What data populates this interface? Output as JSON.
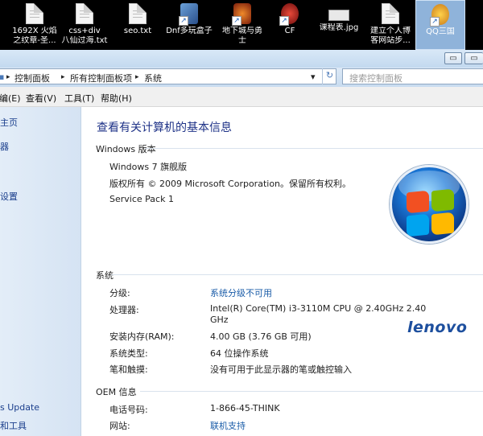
{
  "desktop": {
    "icons": [
      {
        "label": "1692X 火焰",
        "label2": "之纹章-圣..."
      },
      {
        "label": "css+div",
        "label2": "八仙过海.txt"
      },
      {
        "label": "seo.txt",
        "label2": ""
      },
      {
        "label": "Dnf多玩盒子",
        "label2": ""
      },
      {
        "label": "地下城与勇",
        "label2": "士"
      },
      {
        "label": "CF",
        "label2": ""
      },
      {
        "label": "课程表.jpg",
        "label2": ""
      },
      {
        "label": "建立个人博",
        "label2": "客网站步..."
      },
      {
        "label": "QQ三国",
        "label2": ""
      }
    ]
  },
  "window": {
    "minimize_glyph": "▭",
    "close_glyph": "▭"
  },
  "address": {
    "crumbs": [
      "控制面板",
      "所有控制面板项",
      "系统"
    ],
    "separator": "▸",
    "dropdown": "▾",
    "refresh": "↻",
    "search_placeholder": "搜索控制面板"
  },
  "menu": {
    "edit": "编(E)",
    "view": "查看(V)",
    "tools": "工具(T)",
    "help": "帮助(H)"
  },
  "sidebar": {
    "items": [
      "主页",
      "器",
      "设置",
      "s Update",
      "和工具"
    ]
  },
  "main": {
    "title": "查看有关计算机的基本信息",
    "edition": {
      "heading": "Windows 版本",
      "name": "Windows 7 旗舰版",
      "copyright": "版权所有 © 2009 Microsoft Corporation。保留所有权利。",
      "service_pack": "Service Pack 1"
    },
    "system": {
      "heading": "系统",
      "rows": [
        {
          "label": "分级:",
          "value": "系统分级不可用",
          "value2": "",
          "is_link": true
        },
        {
          "label": "处理器:",
          "value": "Intel(R) Core(TM) i3-3110M CPU @ 2.40GHz   2.40",
          "value2": "GHz",
          "is_link": false
        },
        {
          "label": "安装内存(RAM):",
          "value": "4.00 GB (3.76 GB 可用)",
          "value2": "",
          "is_link": false
        },
        {
          "label": "系统类型:",
          "value": "64 位操作系统",
          "value2": "",
          "is_link": false
        },
        {
          "label": "笔和触摸:",
          "value": "没有可用于此显示器的笔或触控输入",
          "value2": "",
          "is_link": false
        }
      ]
    },
    "oem": {
      "heading": "OEM 信息",
      "rows": [
        {
          "label": "电话号码:",
          "value": "1-866-45-THINK",
          "is_link": false
        },
        {
          "label": "网站:",
          "value": "联机支持",
          "is_link": true
        }
      ]
    },
    "oem_logo": "lenovo"
  },
  "colors": {
    "title": "#1e3287",
    "link": "#1a5ca8",
    "sidebar_link": "#1a3e8c",
    "lenovo": "#1d4f9e"
  }
}
